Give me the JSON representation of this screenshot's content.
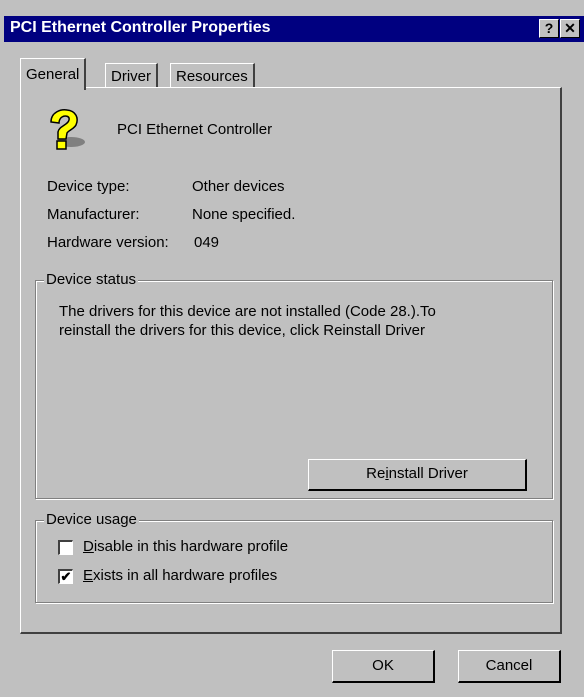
{
  "window": {
    "title": "PCI Ethernet Controller Properties",
    "help_button": "?",
    "close_button": "✕"
  },
  "tabs": [
    {
      "label": "General",
      "active": true
    },
    {
      "label": "Driver",
      "active": false
    },
    {
      "label": "Resources",
      "active": false
    }
  ],
  "general": {
    "device_name": "PCI Ethernet Controller",
    "device_icon": "unknown-device-question-mark-icon",
    "fields": [
      {
        "label": "Device type:",
        "value": "Other devices"
      },
      {
        "label": "Manufacturer:",
        "value": "None specified."
      },
      {
        "label": "Hardware version:",
        "value": "049"
      }
    ],
    "device_status": {
      "legend": "Device status",
      "line1": "The drivers for this device are not installed  (Code 28.).To",
      "line2": "reinstall the drivers for this device, click Reinstall Driver",
      "button_pre": "Re",
      "button_hotkey": "i",
      "button_post": "nstall Driver"
    },
    "device_usage": {
      "legend": "Device usage",
      "options": [
        {
          "hotkey": "D",
          "rest": "isable in this hardware profile",
          "checked": false,
          "mark": ""
        },
        {
          "hotkey": "E",
          "rest": "xists in all hardware profiles",
          "checked": true,
          "mark": "✔"
        }
      ]
    }
  },
  "footer": {
    "ok_label": "OK",
    "cancel_label": "Cancel"
  }
}
